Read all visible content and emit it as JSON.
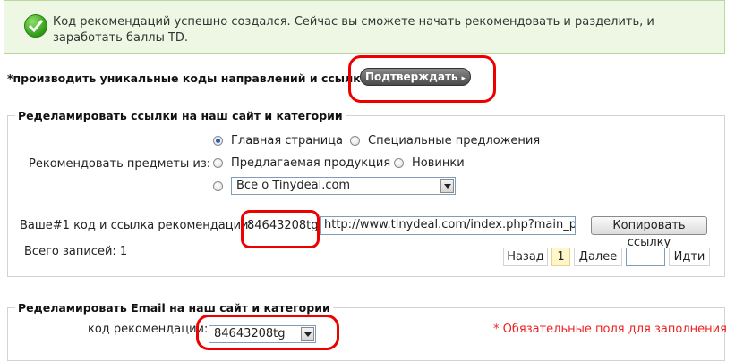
{
  "banner": {
    "message": "Код рекомендаций успешно создался. Сейчас вы сможете начать рекомендовать и разделить, и заработать баллы TD."
  },
  "generate": {
    "label": "*производить уникальные коды направлений и ссылки",
    "confirm_button": "Подтверждать"
  },
  "links_section": {
    "legend": "Ределамировать ссылки на наш сайт и категории",
    "recommend_label": "Рекомендовать предметы из:",
    "options": {
      "home": "Главная страница",
      "specials": "Специальные предложения",
      "featured": "Предлагаемая продукция",
      "new": "Новинки"
    },
    "selected_option": "home",
    "category_select": "Все о Tinydeal.com",
    "code_label": "Ваше#1 код и ссылка рекомендации:",
    "code_value": "84643208tg",
    "link_value": "http://www.tinydeal.com/index.php?main_page=i",
    "copy_button": "Копировать ссылку",
    "total_records": "Всего записей: 1",
    "pagination": {
      "prev": "Назад",
      "current": "1",
      "next": "Далее",
      "page_input": "",
      "go": "Идти"
    }
  },
  "email_section": {
    "legend": "Ределамировать Email на наш сайт и категории",
    "code_label": "код рекомендации:",
    "code_select": "84643208tg",
    "required_note": "* Обязательные поля для заполнения"
  },
  "colors": {
    "highlight": "#e00000",
    "success_bg": "#eef7e3",
    "required": "#e22222"
  }
}
